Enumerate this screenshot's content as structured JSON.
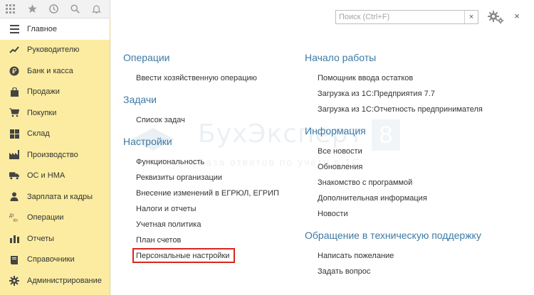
{
  "topbar": {
    "icons": [
      "grid-icon",
      "star-icon",
      "history-icon",
      "search-icon",
      "bell-icon"
    ]
  },
  "sidebar": {
    "items": [
      {
        "label": "Главное",
        "icon": "menu-lines-icon",
        "active": true
      },
      {
        "label": "Руководителю",
        "icon": "trend-icon"
      },
      {
        "label": "Банк и касса",
        "icon": "ruble-coin-icon"
      },
      {
        "label": "Продажи",
        "icon": "bag-icon"
      },
      {
        "label": "Покупки",
        "icon": "cart-icon"
      },
      {
        "label": "Склад",
        "icon": "warehouse-icon"
      },
      {
        "label": "Производство",
        "icon": "factory-icon"
      },
      {
        "label": "ОС и НМА",
        "icon": "truck-icon"
      },
      {
        "label": "Зарплата и кадры",
        "icon": "person-icon"
      },
      {
        "label": "Операции",
        "icon": "dt-kt-icon"
      },
      {
        "label": "Отчеты",
        "icon": "bar-chart-icon"
      },
      {
        "label": "Справочники",
        "icon": "book-icon"
      },
      {
        "label": "Администрирование",
        "icon": "gear-icon"
      }
    ]
  },
  "search": {
    "placeholder": "Поиск (Ctrl+F)",
    "value": "",
    "clear_label": "×"
  },
  "header_close_label": "×",
  "watermark": {
    "title": "БухЭксперт",
    "number": "8",
    "subtitle": "База ответов по учету в 1С"
  },
  "left_column": {
    "sections": [
      {
        "title": "Операции",
        "links": [
          "Ввести хозяйственную операцию"
        ]
      },
      {
        "title": "Задачи",
        "links": [
          "Список задач"
        ]
      },
      {
        "title": "Настройки",
        "links": [
          "Функциональность",
          "Реквизиты организации",
          "Внесение изменений в ЕГРЮЛ, ЕГРИП",
          "Налоги и отчеты",
          "Учетная политика",
          "План счетов",
          "Персональные настройки"
        ]
      }
    ]
  },
  "right_column": {
    "sections": [
      {
        "title": "Начало работы",
        "links": [
          "Помощник ввода остатков",
          "Загрузка из 1С:Предприятия 7.7",
          "Загрузка из 1С:Отчетность предпринимателя"
        ]
      },
      {
        "title": "Информация",
        "links": [
          "Все новости",
          "Обновления",
          "Знакомство с программой",
          "Дополнительная информация",
          "Новости"
        ]
      },
      {
        "title": "Обращение в техническую поддержку",
        "links": [
          "Написать пожелание",
          "Задать вопрос"
        ]
      }
    ]
  },
  "highlight_color": "#d9251c",
  "accent_color": "#3c7aa6",
  "sidebar_color": "#fbeca1"
}
